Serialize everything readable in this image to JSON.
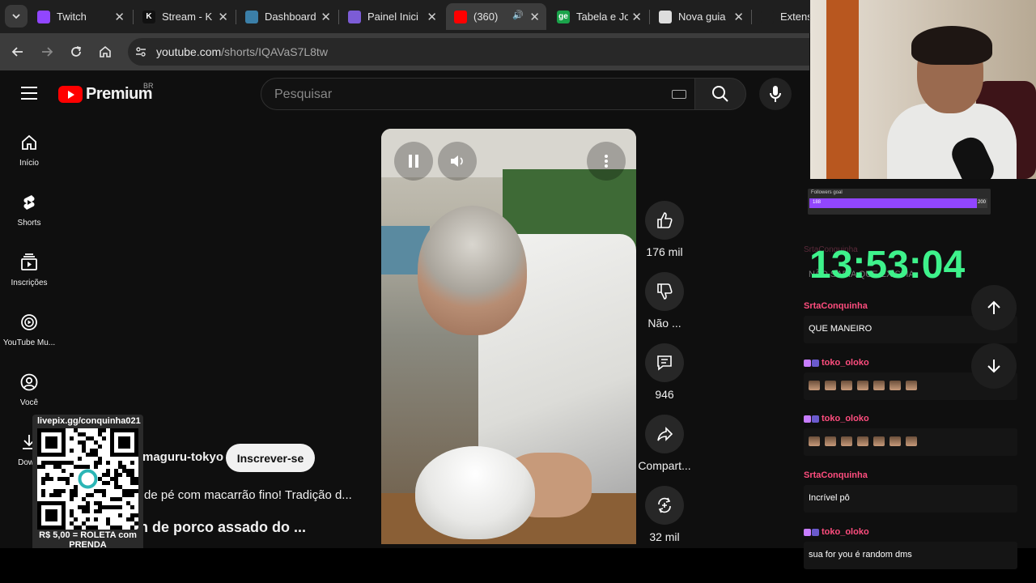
{
  "browser": {
    "tabs": [
      {
        "label": "Twitch",
        "favicon_color": "#9146ff",
        "favicon_text": "",
        "active": false
      },
      {
        "label": "Stream - K",
        "favicon_color": "#111111",
        "favicon_text": "K",
        "active": false
      },
      {
        "label": "Dashboard",
        "favicon_color": "#3b7fa8",
        "favicon_text": "",
        "active": false
      },
      {
        "label": "Painel Inici",
        "favicon_color": "#7c5cd6",
        "favicon_text": "",
        "active": false
      },
      {
        "label": "(360) ",
        "favicon_color": "#ff0000",
        "favicon_text": "",
        "active": true
      },
      {
        "label": "Tabela e Jo",
        "favicon_color": "#1aa34a",
        "favicon_text": "ge",
        "active": false
      },
      {
        "label": "Nova guia",
        "favicon_color": "#dddddd",
        "favicon_text": "",
        "active": false
      },
      {
        "label": "Extens",
        "favicon_color": "#1f1f1f",
        "favicon_text": "",
        "active": false
      }
    ],
    "address": {
      "host": "youtube.com",
      "path": "/shorts/IQAVaS7L8tw"
    }
  },
  "youtube": {
    "logo_text": "Premium",
    "region": "BR",
    "search_placeholder": "Pesquisar",
    "guide": [
      {
        "label": "Início",
        "icon": "home-icon"
      },
      {
        "label": "Shorts",
        "icon": "shorts-icon"
      },
      {
        "label": "Inscrições",
        "icon": "subscriptions-icon"
      },
      {
        "label": "YouTube Mu...",
        "icon": "youtube-music-icon"
      },
      {
        "label": "Você",
        "icon": "you-icon"
      },
      {
        "label": "Downl",
        "icon": "download-icon"
      }
    ],
    "actions": {
      "like": "176 mil",
      "dislike": "Não ...",
      "comments": "946",
      "share": "Compart...",
      "remix": "32 mil"
    },
    "channel_name": "maguru-tokyo",
    "subscribe_label": "Inscrever-se",
    "description": "de pé com macarrão fino! Tradição d...",
    "title_line": "n de porco assado do ..."
  },
  "overlay": {
    "qr_url": "livepix.gg/conquinha021",
    "qr_caption": "R$ 5,00 = ROLETA com PRENDA",
    "goal": {
      "title": "Followers goal",
      "current": "188",
      "target": "200",
      "current_value": 188,
      "target_value": 200
    },
    "clock": "13:53:04",
    "ghost_user": "SrtaConquinha",
    "ghost_text": "NÃO SABIA QUE EXISTIA",
    "chat": [
      {
        "user": "SrtaConquinha",
        "text": "QUE MANEIRO",
        "badges": 0,
        "emotes": 0
      },
      {
        "user": "toko_oloko",
        "text": "",
        "badges": 2,
        "emotes": 7
      },
      {
        "user": "toko_oloko",
        "text": "",
        "badges": 2,
        "emotes": 7
      },
      {
        "user": "SrtaConquinha",
        "text": "Incrível pô",
        "badges": 0,
        "emotes": 0
      },
      {
        "user": "toko_oloko",
        "text": "sua for you é random dms",
        "badges": 2,
        "emotes": 0
      }
    ]
  }
}
